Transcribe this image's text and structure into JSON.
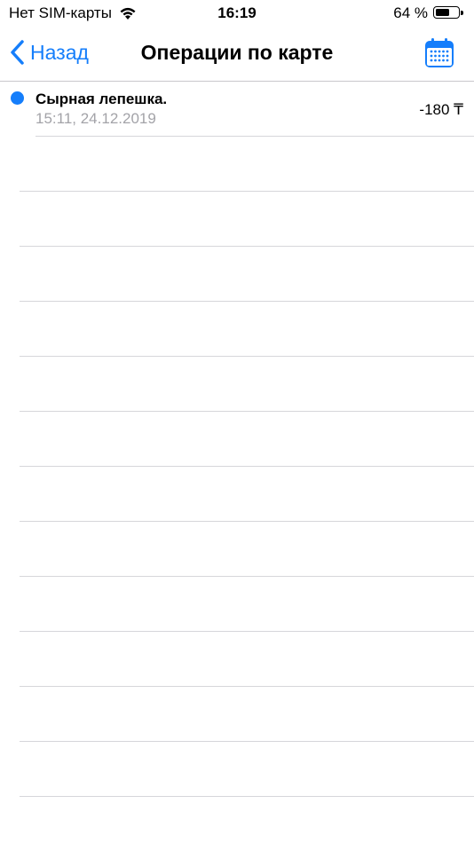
{
  "status_bar": {
    "carrier": "Нет SIM-карты",
    "time": "16:19",
    "battery_percent_text": "64 %",
    "battery_level": 0.64
  },
  "nav": {
    "back_label": "Назад",
    "title": "Операции по карте",
    "calendar_icon": "calendar-icon"
  },
  "operations": [
    {
      "title": "Сырная лепешка.",
      "datetime": "15:11, 24.12.2019",
      "amount": "-180 ₸",
      "unread": true
    }
  ],
  "colors": {
    "accent": "#157efb",
    "secondary_text": "#a3a3a8",
    "separator": "#d6d6da"
  }
}
